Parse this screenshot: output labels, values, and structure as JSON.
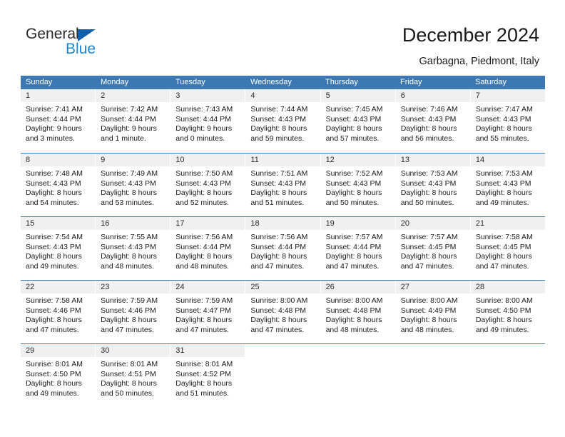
{
  "brand": {
    "name_part1": "General",
    "name_part2": "Blue",
    "triangle_color": "#1060aa",
    "part1_color": "#2b2b2b",
    "part2_color": "#1b87d8"
  },
  "header": {
    "title": "December 2024",
    "subtitle": "Garbagna, Piedmont, Italy"
  },
  "theme": {
    "header_row_bg": "#3c78b4",
    "header_row_text": "#ffffff",
    "day_band_bg": "#f0f0f0",
    "cell_bg": "#ffffff",
    "row_divider": "#3c78b4"
  },
  "calendar": {
    "weekday_headers": [
      "Sunday",
      "Monday",
      "Tuesday",
      "Wednesday",
      "Thursday",
      "Friday",
      "Saturday"
    ],
    "weeks": [
      [
        {
          "day": "1",
          "lines": [
            "Sunrise: 7:41 AM",
            "Sunset: 4:44 PM",
            "Daylight: 9 hours",
            "and 3 minutes."
          ]
        },
        {
          "day": "2",
          "lines": [
            "Sunrise: 7:42 AM",
            "Sunset: 4:44 PM",
            "Daylight: 9 hours",
            "and 1 minute."
          ]
        },
        {
          "day": "3",
          "lines": [
            "Sunrise: 7:43 AM",
            "Sunset: 4:44 PM",
            "Daylight: 9 hours",
            "and 0 minutes."
          ]
        },
        {
          "day": "4",
          "lines": [
            "Sunrise: 7:44 AM",
            "Sunset: 4:43 PM",
            "Daylight: 8 hours",
            "and 59 minutes."
          ]
        },
        {
          "day": "5",
          "lines": [
            "Sunrise: 7:45 AM",
            "Sunset: 4:43 PM",
            "Daylight: 8 hours",
            "and 57 minutes."
          ]
        },
        {
          "day": "6",
          "lines": [
            "Sunrise: 7:46 AM",
            "Sunset: 4:43 PM",
            "Daylight: 8 hours",
            "and 56 minutes."
          ]
        },
        {
          "day": "7",
          "lines": [
            "Sunrise: 7:47 AM",
            "Sunset: 4:43 PM",
            "Daylight: 8 hours",
            "and 55 minutes."
          ]
        }
      ],
      [
        {
          "day": "8",
          "lines": [
            "Sunrise: 7:48 AM",
            "Sunset: 4:43 PM",
            "Daylight: 8 hours",
            "and 54 minutes."
          ]
        },
        {
          "day": "9",
          "lines": [
            "Sunrise: 7:49 AM",
            "Sunset: 4:43 PM",
            "Daylight: 8 hours",
            "and 53 minutes."
          ]
        },
        {
          "day": "10",
          "lines": [
            "Sunrise: 7:50 AM",
            "Sunset: 4:43 PM",
            "Daylight: 8 hours",
            "and 52 minutes."
          ]
        },
        {
          "day": "11",
          "lines": [
            "Sunrise: 7:51 AM",
            "Sunset: 4:43 PM",
            "Daylight: 8 hours",
            "and 51 minutes."
          ]
        },
        {
          "day": "12",
          "lines": [
            "Sunrise: 7:52 AM",
            "Sunset: 4:43 PM",
            "Daylight: 8 hours",
            "and 50 minutes."
          ]
        },
        {
          "day": "13",
          "lines": [
            "Sunrise: 7:53 AM",
            "Sunset: 4:43 PM",
            "Daylight: 8 hours",
            "and 50 minutes."
          ]
        },
        {
          "day": "14",
          "lines": [
            "Sunrise: 7:53 AM",
            "Sunset: 4:43 PM",
            "Daylight: 8 hours",
            "and 49 minutes."
          ]
        }
      ],
      [
        {
          "day": "15",
          "lines": [
            "Sunrise: 7:54 AM",
            "Sunset: 4:43 PM",
            "Daylight: 8 hours",
            "and 49 minutes."
          ]
        },
        {
          "day": "16",
          "lines": [
            "Sunrise: 7:55 AM",
            "Sunset: 4:43 PM",
            "Daylight: 8 hours",
            "and 48 minutes."
          ]
        },
        {
          "day": "17",
          "lines": [
            "Sunrise: 7:56 AM",
            "Sunset: 4:44 PM",
            "Daylight: 8 hours",
            "and 48 minutes."
          ]
        },
        {
          "day": "18",
          "lines": [
            "Sunrise: 7:56 AM",
            "Sunset: 4:44 PM",
            "Daylight: 8 hours",
            "and 47 minutes."
          ]
        },
        {
          "day": "19",
          "lines": [
            "Sunrise: 7:57 AM",
            "Sunset: 4:44 PM",
            "Daylight: 8 hours",
            "and 47 minutes."
          ]
        },
        {
          "day": "20",
          "lines": [
            "Sunrise: 7:57 AM",
            "Sunset: 4:45 PM",
            "Daylight: 8 hours",
            "and 47 minutes."
          ]
        },
        {
          "day": "21",
          "lines": [
            "Sunrise: 7:58 AM",
            "Sunset: 4:45 PM",
            "Daylight: 8 hours",
            "and 47 minutes."
          ]
        }
      ],
      [
        {
          "day": "22",
          "lines": [
            "Sunrise: 7:58 AM",
            "Sunset: 4:46 PM",
            "Daylight: 8 hours",
            "and 47 minutes."
          ]
        },
        {
          "day": "23",
          "lines": [
            "Sunrise: 7:59 AM",
            "Sunset: 4:46 PM",
            "Daylight: 8 hours",
            "and 47 minutes."
          ]
        },
        {
          "day": "24",
          "lines": [
            "Sunrise: 7:59 AM",
            "Sunset: 4:47 PM",
            "Daylight: 8 hours",
            "and 47 minutes."
          ]
        },
        {
          "day": "25",
          "lines": [
            "Sunrise: 8:00 AM",
            "Sunset: 4:48 PM",
            "Daylight: 8 hours",
            "and 47 minutes."
          ]
        },
        {
          "day": "26",
          "lines": [
            "Sunrise: 8:00 AM",
            "Sunset: 4:48 PM",
            "Daylight: 8 hours",
            "and 48 minutes."
          ]
        },
        {
          "day": "27",
          "lines": [
            "Sunrise: 8:00 AM",
            "Sunset: 4:49 PM",
            "Daylight: 8 hours",
            "and 48 minutes."
          ]
        },
        {
          "day": "28",
          "lines": [
            "Sunrise: 8:00 AM",
            "Sunset: 4:50 PM",
            "Daylight: 8 hours",
            "and 49 minutes."
          ]
        }
      ],
      [
        {
          "day": "29",
          "lines": [
            "Sunrise: 8:01 AM",
            "Sunset: 4:50 PM",
            "Daylight: 8 hours",
            "and 49 minutes."
          ]
        },
        {
          "day": "30",
          "lines": [
            "Sunrise: 8:01 AM",
            "Sunset: 4:51 PM",
            "Daylight: 8 hours",
            "and 50 minutes."
          ]
        },
        {
          "day": "31",
          "lines": [
            "Sunrise: 8:01 AM",
            "Sunset: 4:52 PM",
            "Daylight: 8 hours",
            "and 51 minutes."
          ]
        },
        {
          "day": "",
          "lines": []
        },
        {
          "day": "",
          "lines": []
        },
        {
          "day": "",
          "lines": []
        },
        {
          "day": "",
          "lines": []
        }
      ]
    ]
  }
}
